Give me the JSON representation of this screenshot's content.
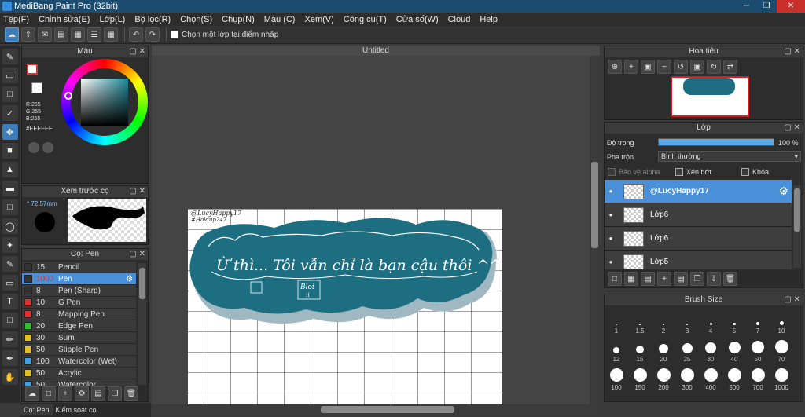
{
  "window": {
    "title": "MediBang Paint Pro (32bit)"
  },
  "menu": [
    "Tệp(F)",
    "Chỉnh sửa(E)",
    "Lớp(L)",
    "Bộ lọc(R)",
    "Chọn(S)",
    "Chụp(N)",
    "Màu (C)",
    "Xem(V)",
    "Công cụ(T)",
    "Cửa sổ(W)",
    "Cloud",
    "Help"
  ],
  "toolbar": {
    "checkbox_label": "Chọn một lớp tại điểm nhấp"
  },
  "color_panel": {
    "title": "Màu",
    "rgb": [
      "R:255",
      "G:255",
      "B:255"
    ],
    "hex": "#FFFFFF",
    "primary_color": "#ffffff",
    "wheel_inner": "#1e8a9a"
  },
  "preview_panel": {
    "title": "Xem trước cọ",
    "size": "72.57mm"
  },
  "brush_panel": {
    "title": "Cọ: Pen",
    "brushes": [
      {
        "size": "15",
        "name": "Pencil",
        "color": "#333333"
      },
      {
        "size": "1000",
        "name": "Pen",
        "color": "#333333"
      },
      {
        "size": "8",
        "name": "Pen (Sharp)",
        "color": "#333333"
      },
      {
        "size": "10",
        "name": "G Pen",
        "color": "#e03030"
      },
      {
        "size": "8",
        "name": "Mapping Pen",
        "color": "#e03030"
      },
      {
        "size": "20",
        "name": "Edge Pen",
        "color": "#30c030"
      },
      {
        "size": "30",
        "name": "Sumi",
        "color": "#e0c020"
      },
      {
        "size": "50",
        "name": "Stipple Pen",
        "color": "#e0c020"
      },
      {
        "size": "100",
        "name": "Watercolor (Wet)",
        "color": "#40a0e0"
      },
      {
        "size": "50",
        "name": "Acrylic",
        "color": "#e0c020"
      },
      {
        "size": "50",
        "name": "Watercolor",
        "color": "#40a0e0"
      }
    ]
  },
  "bottom_tabs": [
    "Cọ: Pen",
    "Kiểm soát cọ"
  ],
  "canvas": {
    "tab_title": "Untitled",
    "watermark1": "@LucyHappy17",
    "watermark2": "#Holdup247",
    "main_text": "Ừ thì... Tôi vẫn chỉ là bạn cậu thôi ^^",
    "small_text": "Bloi",
    "small_text2": ":(",
    "blob_color": "#1e6e82"
  },
  "navigator_panel": {
    "title": "Hoa tiêu"
  },
  "layer_panel": {
    "title": "Lớp",
    "opacity_label": "Độ trong",
    "opacity_value": "100 %",
    "opacity": 1.0,
    "blend_label": "Pha trộn",
    "blend_value": "Bình thường",
    "protect_alpha": "Bảo vệ alpha",
    "clipping": "Xén bớt",
    "lock": "Khóa",
    "layers": [
      {
        "name": "@LucyHappy17",
        "selected": true
      },
      {
        "name": "Lớp6",
        "selected": false
      },
      {
        "name": "Lớp6",
        "selected": false
      },
      {
        "name": "Lớp5",
        "selected": false
      }
    ]
  },
  "brush_size_panel": {
    "title": "Brush Size",
    "sizes": [
      "1",
      "1.5",
      "2",
      "3",
      "4",
      "5",
      "7",
      "10",
      "12",
      "15",
      "20",
      "25",
      "30",
      "40",
      "50",
      "70",
      "100",
      "150",
      "200",
      "300",
      "400",
      "500",
      "700",
      "1000"
    ]
  }
}
